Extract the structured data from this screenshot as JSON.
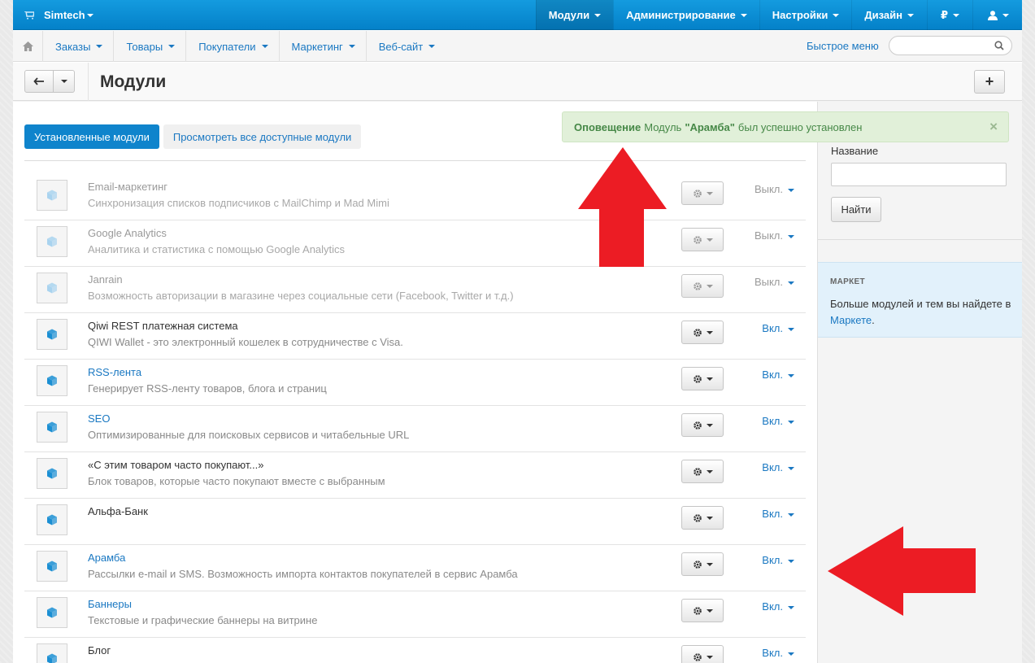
{
  "topbar": {
    "brand": "Simtech",
    "nav": [
      {
        "label": "Модули",
        "active": true
      },
      {
        "label": "Администрирование",
        "active": false
      },
      {
        "label": "Настройки",
        "active": false
      },
      {
        "label": "Дизайн",
        "active": false
      },
      {
        "label": "₽",
        "active": false
      },
      {
        "label": "",
        "active": false
      }
    ]
  },
  "subnav": {
    "items": [
      "Заказы",
      "Товары",
      "Покупатели",
      "Маркетинг",
      "Веб-сайт"
    ],
    "quick_menu": "Быстрое меню",
    "search_placeholder": ""
  },
  "title": "Модули",
  "tabs": {
    "installed": "Установленные модули",
    "all": "Просмотреть все доступные модули"
  },
  "modules": [
    {
      "name": "Email-маркетинг",
      "description": "Синхронизация списков подписчиков с MailChimp и Mad Mimi",
      "status": "Выкл.",
      "enabled": false,
      "link": true
    },
    {
      "name": "Google Analytics",
      "description": "Аналитика и статистика с помощью Google Analytics",
      "status": "Выкл.",
      "enabled": false,
      "link": false
    },
    {
      "name": "Janrain",
      "description": "Возможность авторизации в магазине через социальные сети (Facebook, Twitter и т.д.)",
      "status": "Выкл.",
      "enabled": false,
      "link": false
    },
    {
      "name": "Qiwi REST платежная система",
      "description": "QIWI Wallet - это электронный кошелек в сотрудничестве с Visa.",
      "status": "Вкл.",
      "enabled": true,
      "link": false
    },
    {
      "name": "RSS-лента",
      "description": "Генерирует RSS-ленту товаров, блога и страниц",
      "status": "Вкл.",
      "enabled": true,
      "link": true
    },
    {
      "name": "SEO",
      "description": "Оптимизированные для поисковых сервисов и читабельные URL",
      "status": "Вкл.",
      "enabled": true,
      "link": true
    },
    {
      "name": "«С этим товаром часто покупают...»",
      "description": "Блок товаров, которые часто покупают вместе с выбранным",
      "status": "Вкл.",
      "enabled": true,
      "link": false
    },
    {
      "name": "Альфа-Банк",
      "description": "",
      "status": "Вкл.",
      "enabled": true,
      "link": false
    },
    {
      "name": "Арамба",
      "description": "Рассылки e-mail и SMS. Возможность импорта контактов покупателей в сервис Арамба",
      "status": "Вкл.",
      "enabled": true,
      "link": true
    },
    {
      "name": "Баннеры",
      "description": "Текстовые и графические баннеры на витрине",
      "status": "Вкл.",
      "enabled": true,
      "link": true
    },
    {
      "name": "Блог",
      "description": "",
      "status": "Вкл.",
      "enabled": true,
      "link": false
    }
  ],
  "sidebar": {
    "filter_label": "Название",
    "find_button": "Найти",
    "market_heading": "МАРКЕТ",
    "market_text": "Больше модулей и тем вы найдете в",
    "market_link": "Маркете",
    "market_after": "."
  },
  "notification": {
    "title": "Оповещение",
    "text_before": "Модуль",
    "module": "\"Арамба\"",
    "text_after": "был успешно установлен"
  },
  "colors": {
    "topbar": "#0a8fd6",
    "link": "#1a78c2",
    "active_tab": "#0f84cc",
    "notification_bg": "#e1f0d9",
    "arrow": "#ec1c24"
  }
}
